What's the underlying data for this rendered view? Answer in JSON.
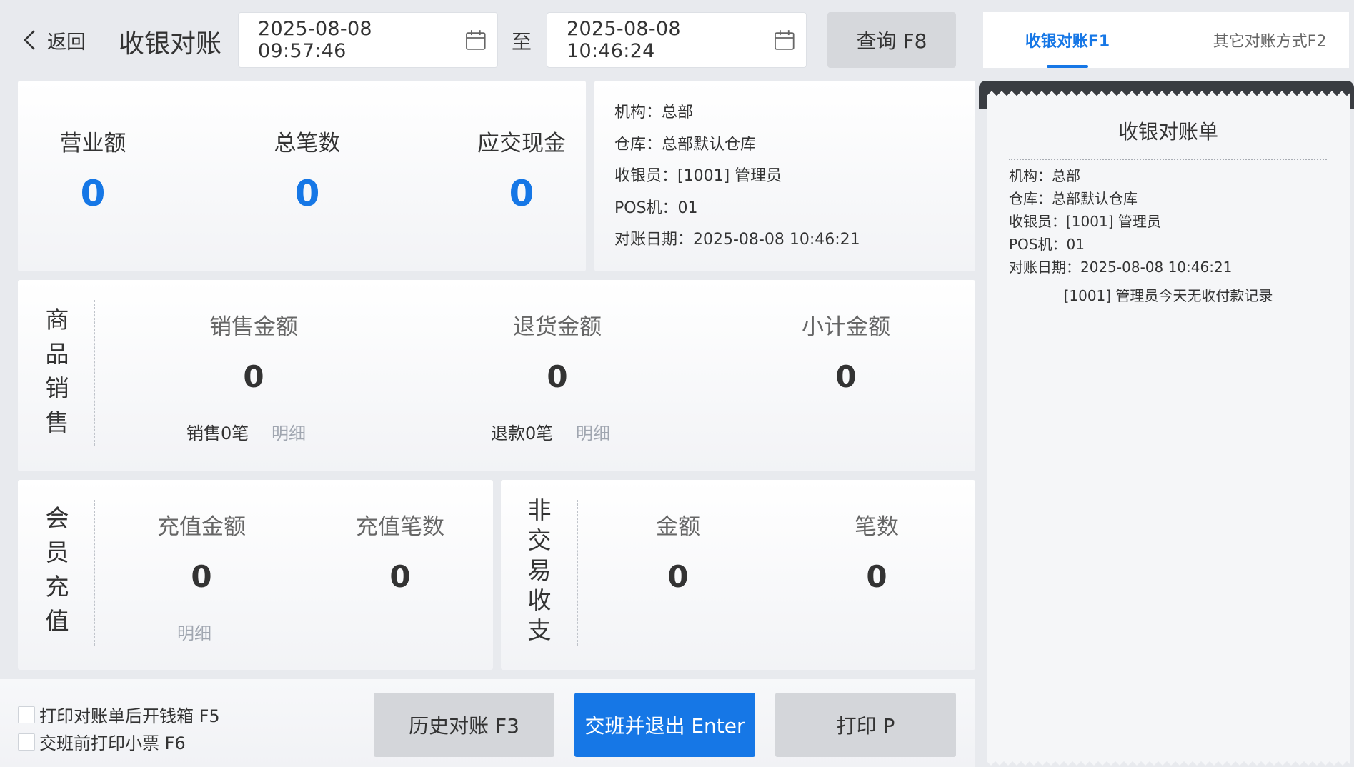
{
  "header": {
    "back_label": "返回",
    "title": "收银对账",
    "start_time": "2025-08-08 09:57:46",
    "to_label": "至",
    "end_time": "2025-08-08 10:46:24",
    "query_label": "查询 F8"
  },
  "tabs": [
    {
      "label": "收银对账F1",
      "active": true
    },
    {
      "label": "其它对账方式F2",
      "active": false
    }
  ],
  "summary": {
    "revenue_label": "营业额",
    "revenue_value": "0",
    "count_label": "总笔数",
    "count_value": "0",
    "cash_label": "应交现金",
    "cash_value": "0"
  },
  "info": {
    "org": "机构：总部",
    "warehouse": "仓库：总部默认仓库",
    "cashier": "收银员：[1001] 管理员",
    "pos": "POS机：01",
    "date": "对账日期：2025-08-08 10:46:21"
  },
  "goods_sales": {
    "title_chars": [
      "商",
      "品",
      "销",
      "售"
    ],
    "sales_label": "销售金额",
    "sales_value": "0",
    "return_label": "退货金额",
    "return_value": "0",
    "subtotal_label": "小计金额",
    "subtotal_value": "0",
    "sales_count": "销售0笔",
    "sales_detail": "明细",
    "refund_count": "退款0笔",
    "refund_detail": "明细"
  },
  "member_recharge": {
    "title_chars": [
      "会",
      "员",
      "充",
      "值"
    ],
    "amount_label": "充值金额",
    "amount_value": "0",
    "count_label": "充值笔数",
    "count_value": "0",
    "detail": "明细"
  },
  "non_trade": {
    "title_chars": [
      "非",
      "交",
      "易",
      "收",
      "支"
    ],
    "amount_label": "金额",
    "amount_value": "0",
    "count_label": "笔数",
    "count_value": "0"
  },
  "bottom": {
    "open_drawer_label": "打印对账单后开钱箱 F5",
    "print_ticket_label": "交班前打印小票 F6",
    "history_label": "历史对账 F3",
    "handover_label": "交班并退出 Enter",
    "print_label": "打印 P"
  },
  "receipt": {
    "title": "收银对账单",
    "lines": [
      "机构：总部",
      "仓库：总部默认仓库",
      "收银员：[1001] 管理员",
      "POS机：01",
      "对账日期：2025-08-08 10:46:21"
    ],
    "note": "[1001] 管理员今天无收付款记录"
  },
  "colors": {
    "accent": "#1677e6",
    "background": "#e8eaee",
    "button_grey": "#d4d6da"
  },
  "icons": {
    "back": "chevron-left-icon",
    "calendar": "calendar-icon"
  }
}
